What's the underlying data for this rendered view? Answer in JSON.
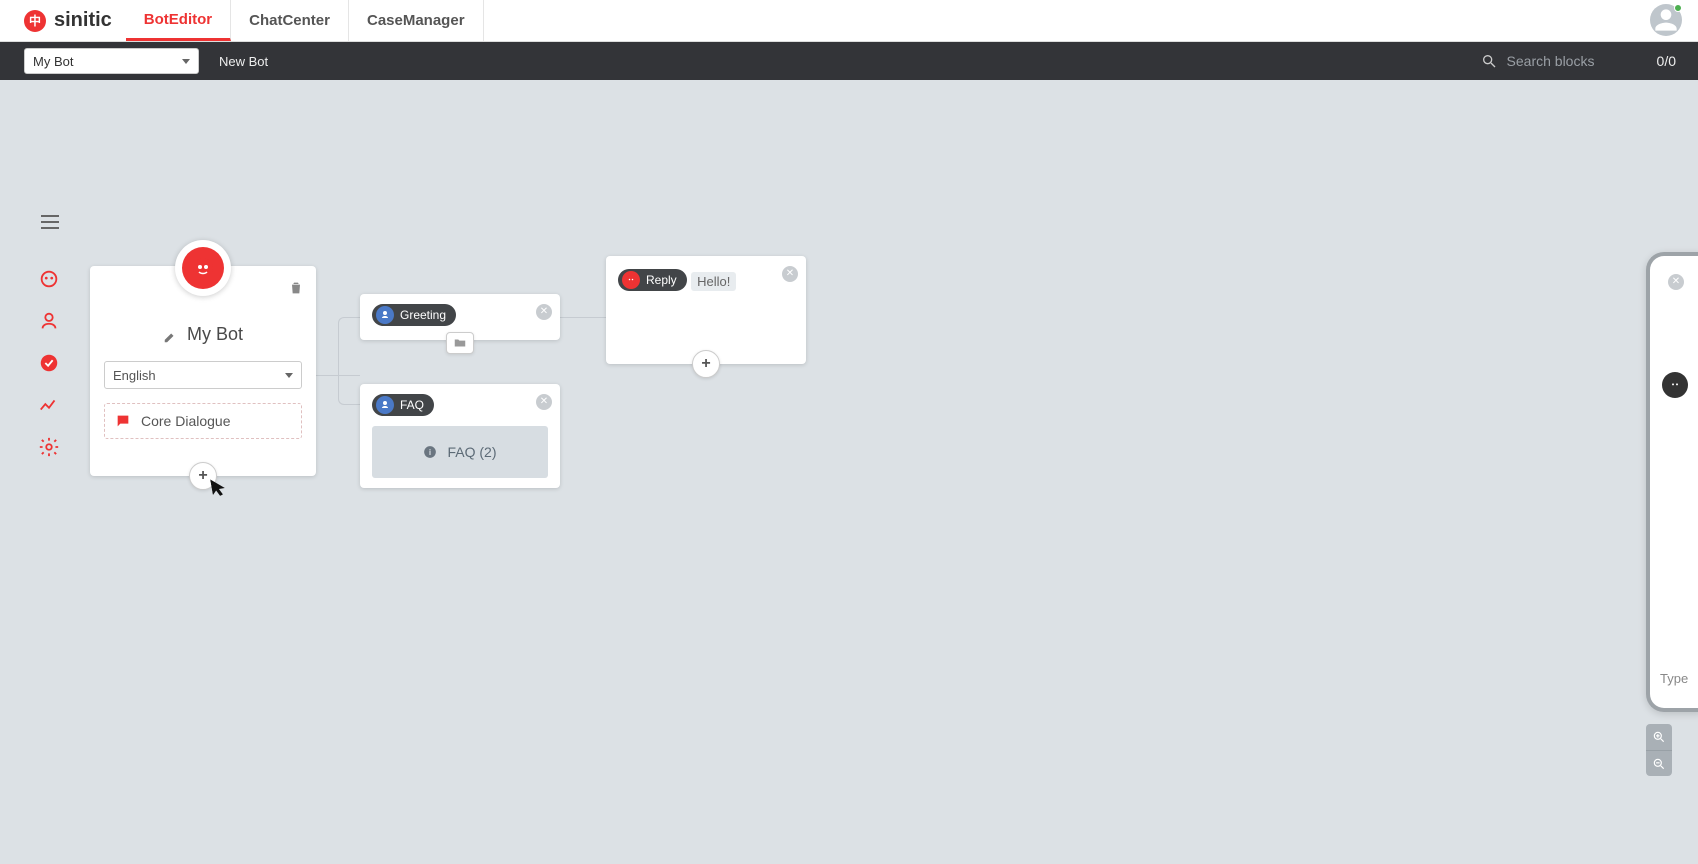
{
  "brand": {
    "name": "sinitic"
  },
  "nav": {
    "tabs": [
      "BotEditor",
      "ChatCenter",
      "CaseManager"
    ],
    "active": 0
  },
  "subnav": {
    "bot_select": "My Bot",
    "new_bot": "New Bot",
    "search_placeholder": "Search blocks",
    "counter": "0/0"
  },
  "botcard": {
    "name": "My Bot",
    "language": "English",
    "dialogue": "Core Dialogue"
  },
  "blocks": {
    "greeting": {
      "label": "Greeting"
    },
    "faq": {
      "label": "FAQ",
      "inner": "FAQ (2)"
    },
    "reply": {
      "label": "Reply",
      "text": "Hello!"
    }
  },
  "preview": {
    "input_placeholder": "Type"
  },
  "colors": {
    "accent": "#e33",
    "user": "#4a79c7",
    "canvas": "#dce1e5"
  }
}
